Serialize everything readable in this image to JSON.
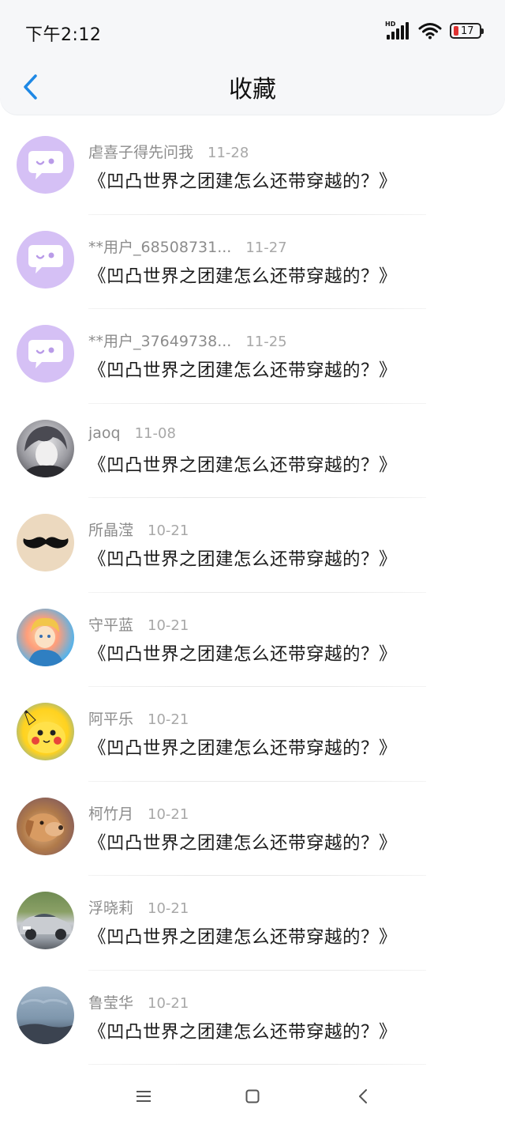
{
  "status_bar": {
    "time": "下午2:12",
    "network_label": "HD",
    "battery_level": "17"
  },
  "header": {
    "title": "收藏"
  },
  "items": [
    {
      "name": "虐喜子得先问我",
      "date": "11-28",
      "title": "《凹凸世界之团建怎么还带穿越的？》",
      "avatar": "chat-bubble"
    },
    {
      "name": "**用户_68508731...",
      "date": "11-27",
      "title": "《凹凸世界之团建怎么还带穿越的？》",
      "avatar": "chat-bubble"
    },
    {
      "name": "**用户_37649738...",
      "date": "11-25",
      "title": "《凹凸世界之团建怎么还带穿越的？》",
      "avatar": "chat-bubble"
    },
    {
      "name": "jaoq",
      "date": "11-08",
      "title": "《凹凸世界之团建怎么还带穿越的？》",
      "avatar": "anime-portrait"
    },
    {
      "name": "所晶滢",
      "date": "10-21",
      "title": "《凹凸世界之团建怎么还带穿越的？》",
      "avatar": "mustache"
    },
    {
      "name": "守平蓝",
      "date": "10-21",
      "title": "《凹凸世界之团建怎么还带穿越的？》",
      "avatar": "cartoon-character"
    },
    {
      "name": "阿平乐",
      "date": "10-21",
      "title": "《凹凸世界之团建怎么还带穿越的？》",
      "avatar": "pikachu"
    },
    {
      "name": "柯竹月",
      "date": "10-21",
      "title": "《凹凸世界之团建怎么还带穿越的？》",
      "avatar": "dog-photo"
    },
    {
      "name": "浮晓莉",
      "date": "10-21",
      "title": "《凹凸世界之团建怎么还带穿越的？》",
      "avatar": "car-photo"
    },
    {
      "name": "鲁莹华",
      "date": "10-21",
      "title": "《凹凸世界之团建怎么还带穿越的？》",
      "avatar": "sky-photo"
    }
  ],
  "colors": {
    "accent": "#1e88e5",
    "default_avatar_bg": "#d5c0f5"
  }
}
